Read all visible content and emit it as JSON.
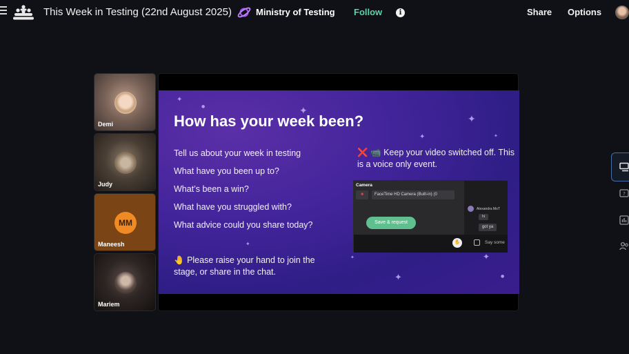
{
  "header": {
    "title": "This Week in Testing (22nd August 2025)",
    "organization": "Ministry of Testing",
    "follow_label": "Follow",
    "info_glyph": "i",
    "share_label": "Share",
    "options_label": "Options",
    "accent_color": "#5fd3a8"
  },
  "participants": [
    {
      "name": "Demi",
      "type": "video"
    },
    {
      "name": "Judy",
      "type": "video"
    },
    {
      "name": "Maneesh",
      "type": "initials",
      "initials": "MM",
      "avatar_color": "#f08a24"
    },
    {
      "name": "Mariem",
      "type": "video"
    }
  ],
  "slide": {
    "title": "How has your week been?",
    "questions": [
      "Tell us about your week in testing",
      "What have you been up to?",
      "What’s been a win?",
      "What have you struggled with?",
      "What advice could you share today?"
    ],
    "raise_hand_emoji": "🤚",
    "raise_hand_text": "Please raise your hand to join the stage, or share in the chat.",
    "voice_note_icons": "❌ 📹",
    "voice_note": "Keep your video switched off. This is a voice only event.",
    "screenshot": {
      "camera_label": "Camera",
      "camera_select": "FaceTime HD Camera (Built-in) (0",
      "save_button": "Save & request",
      "chat_user": "Alexandra MoT",
      "chat_msg1": "hi",
      "chat_msg2": "got ya",
      "chat_placeholder": "Say some"
    }
  },
  "side_panel": {
    "items": [
      "chat-icon",
      "question-icon",
      "poll-icon",
      "people-icon"
    ],
    "active": "chat-icon"
  }
}
